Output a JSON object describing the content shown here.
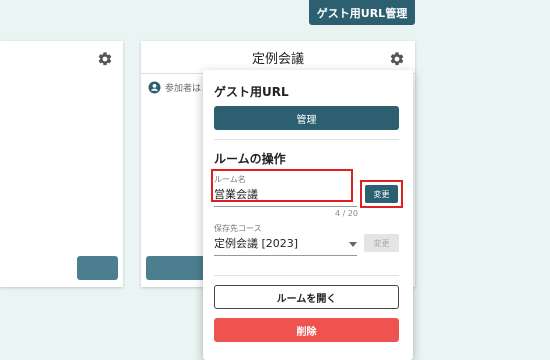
{
  "header": {
    "guest_url_manage_label": "ゲスト用URL管理"
  },
  "cards": {
    "middle": {
      "title": "定例会議",
      "participants_label": "参加者は"
    }
  },
  "popup": {
    "guest_url_title": "ゲスト用URL",
    "manage_label": "管理",
    "room_ops_title": "ルームの操作",
    "room_name": {
      "label": "ルーム名",
      "value": "営業会議",
      "counter": "4 / 20"
    },
    "change_label": "変更",
    "save_dest": {
      "label": "保存先コース",
      "value": "定例会議 [2023]"
    },
    "change_disabled_label": "変更",
    "open_room_label": "ルームを開く",
    "delete_label": "削除"
  },
  "icons": [
    "gear-icon",
    "person-icon",
    "dropdown-arrow-icon"
  ],
  "colors": {
    "accent": "#2c5f70",
    "danger": "#ef5350",
    "highlight": "#e02020"
  }
}
